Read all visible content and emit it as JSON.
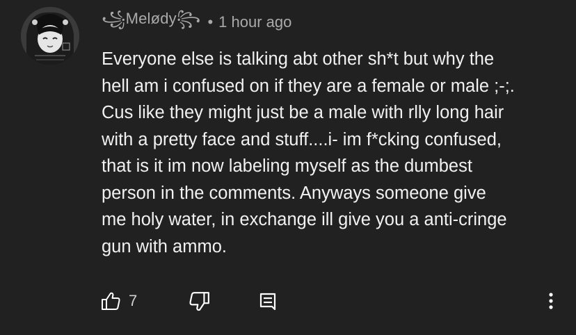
{
  "comment": {
    "author": "꧁Melødy꧂",
    "separator": "•",
    "timestamp": "1 hour ago",
    "body_lines": [
      "Everyone else is talking abt other sh*t but why the",
      "hell am i confused on if they are a female or male ;-;.",
      "Cus like they might just be a male with rlly long hair",
      "with a pretty face and stuff....i- im f*cking confused,",
      "that is it im now labeling myself as the dumbest",
      "person in the comments. Anyways someone give",
      "me holy water, in exchange ill give you a anti-cringe",
      "gun with ammo."
    ]
  },
  "actions": {
    "like_icon": "thumb-up-icon",
    "like_count": "7",
    "dislike_icon": "thumb-down-icon",
    "reply_icon": "reply-comment-icon",
    "more_icon": "more-vertical-icon"
  },
  "colors": {
    "background": "#212121",
    "text_primary": "#f1f1f1",
    "text_secondary": "#aaaaaa"
  }
}
